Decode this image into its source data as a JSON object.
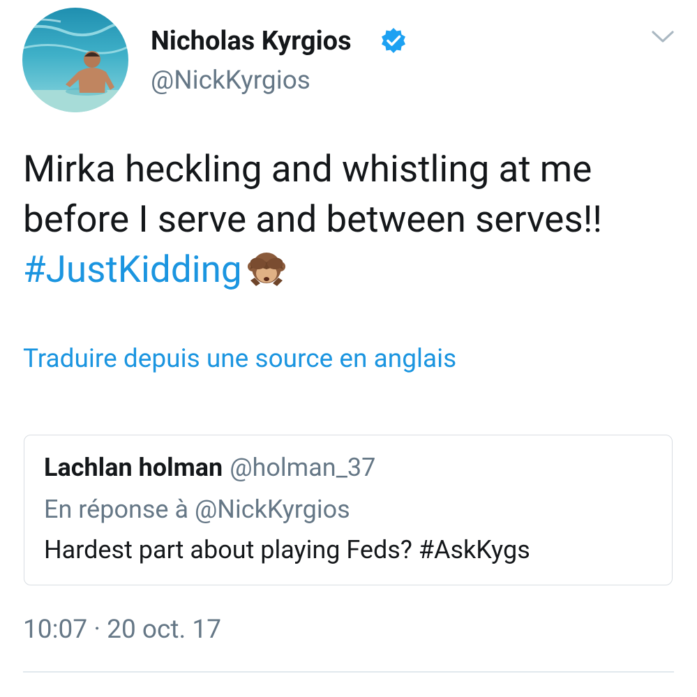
{
  "author": {
    "name": "Nicholas Kyrgios",
    "handle": "@NickKyrgios",
    "verified": true
  },
  "tweet": {
    "text_before_hashtag": "Mirka heckling and whistling at me before I serve and between serves!! ",
    "hashtag": "#JustKidding",
    "emoji": "see-no-evil-monkey"
  },
  "translate_link": "Traduire depuis une source en anglais",
  "quoted_tweet": {
    "name": "Lachlan holman",
    "handle": "@holman_37",
    "reply_context": "En réponse à @NickKyrgios",
    "text": "Hardest part about playing Feds? #AskKygs"
  },
  "timestamp": "10:07 · 20 oct. 17",
  "colors": {
    "link": "#1b95e0",
    "secondary_text": "#657786",
    "primary_text": "#14171a",
    "verified": "#1da1f2"
  }
}
